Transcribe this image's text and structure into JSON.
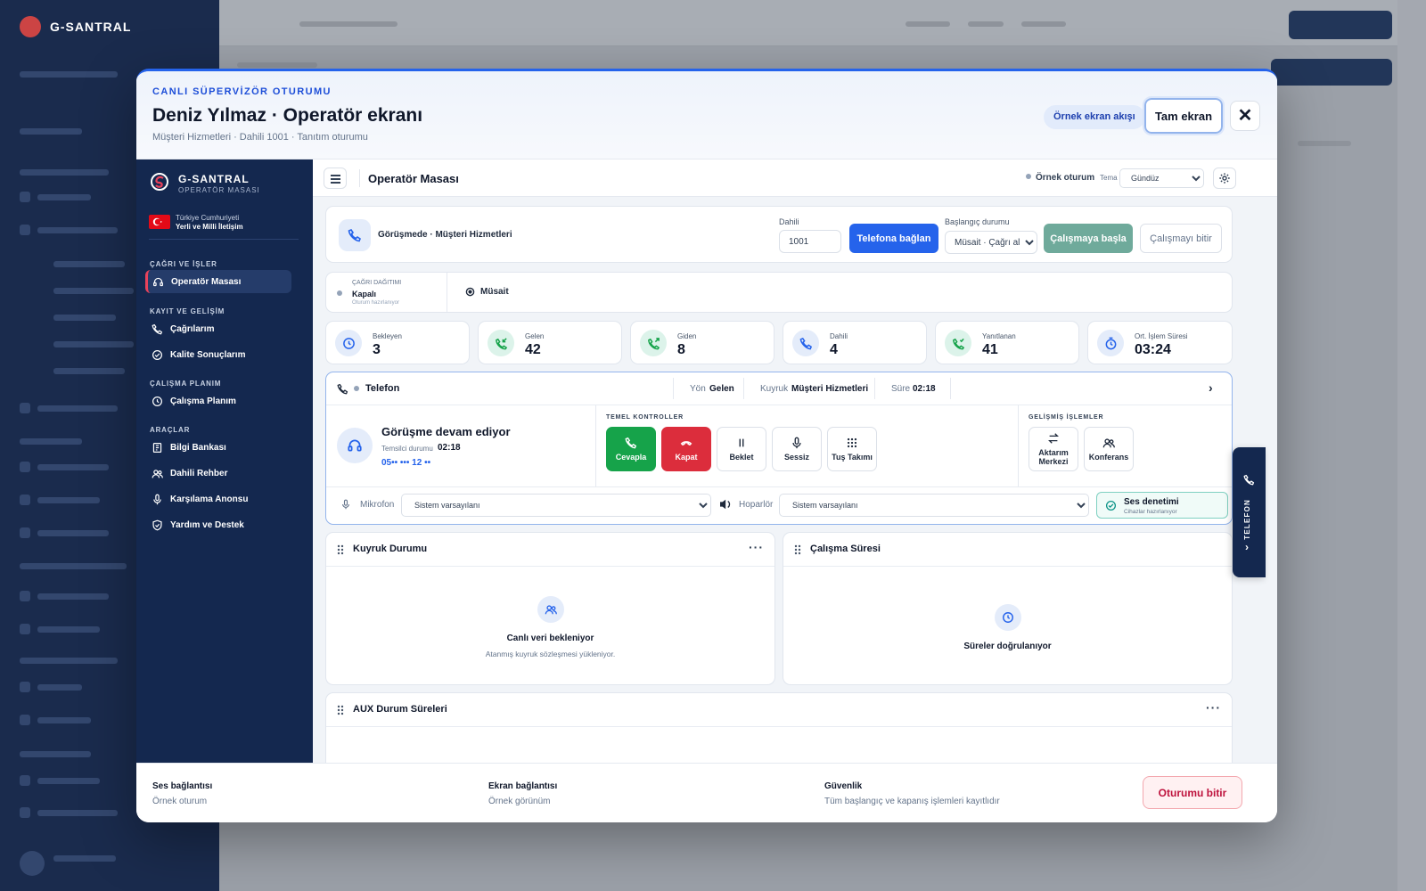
{
  "modal": {
    "eyebrow": "CANLI SÜPERVİZÖR OTURUMU",
    "title": "Deniz Yılmaz · Operatör ekranı",
    "subtitle": "Müşteri Hizmetleri · Dahili 1001 · Tanıtım oturumu",
    "flow_label": "Örnek ekran akışı",
    "fullscreen_label": "Tam ekran",
    "close_glyph": "✕"
  },
  "sidebar": {
    "brand": "G-SANTRAL",
    "brand_sub": "OPERATÖR MASASI",
    "gov_line1": "Türkiye Cumhuriyeti",
    "gov_line2": "Yerli ve Milli İletişim",
    "sections": [
      {
        "title": "ÇAĞRI VE İŞLER",
        "items": [
          {
            "label": "Operatör Masası",
            "icon": "headset-icon",
            "active": true
          }
        ]
      },
      {
        "title": "KAYIT VE GELİŞİM",
        "items": [
          {
            "label": "Çağrılarım",
            "icon": "phone-icon"
          },
          {
            "label": "Kalite Sonuçlarım",
            "icon": "check-badge-icon"
          }
        ]
      },
      {
        "title": "ÇALIŞMA PLANIM",
        "items": [
          {
            "label": "Çalışma Planım",
            "icon": "clock-icon"
          }
        ]
      },
      {
        "title": "ARAÇLAR",
        "items": [
          {
            "label": "Bilgi Bankası",
            "icon": "book-icon"
          },
          {
            "label": "Dahili Rehber",
            "icon": "contacts-icon"
          },
          {
            "label": "Karşılama Anonsu",
            "icon": "mic-icon"
          },
          {
            "label": "Yardım ve Destek",
            "icon": "shield-icon"
          }
        ]
      }
    ]
  },
  "topbar": {
    "title": "Operatör Masası",
    "session": "Örnek oturum",
    "theme_label": "Tema",
    "theme_value": "Gündüz"
  },
  "connect": {
    "status": "Görüşmede · Müşteri Hizmetleri",
    "ext_label": "Dahili",
    "ext_value": "1001",
    "connect_btn": "Telefona bağlan",
    "start_status_label": "Başlangıç durumu",
    "start_status_value": "Müsait · Çağrı al",
    "start_btn": "Çalışmaya başla",
    "stop_btn": "Çalışmayı bitir",
    "colors": {
      "primary": "#2563eb",
      "start": "#6faa9b"
    }
  },
  "distribution": {
    "label": "ÇAĞRI DAĞITIMI",
    "value": "Kapalı",
    "note": "Oturum hazırlanıyor",
    "availability": "Müsait"
  },
  "stats": [
    {
      "label": "Bekleyen",
      "value": "3",
      "icon": "clock-icon",
      "tone": "blue"
    },
    {
      "label": "Gelen",
      "value": "42",
      "icon": "incoming-call-icon",
      "tone": "green"
    },
    {
      "label": "Giden",
      "value": "8",
      "icon": "outgoing-call-icon",
      "tone": "green"
    },
    {
      "label": "Dahili",
      "value": "4",
      "icon": "phone-icon",
      "tone": "blue"
    },
    {
      "label": "Yanıtlanan",
      "value": "41",
      "icon": "answered-call-icon",
      "tone": "green"
    },
    {
      "label": "Ort. İşlem Süresi",
      "value": "03:24",
      "icon": "timer-icon",
      "tone": "blue"
    }
  ],
  "phone": {
    "title": "Telefon",
    "dir_label": "Yön",
    "dir_value": "Gelen",
    "queue_label": "Kuyruk",
    "queue_value": "Müşteri Hizmetleri",
    "dur_label": "Süre",
    "dur_value": "02:18",
    "call_title": "Görüşme devam ediyor",
    "rep_label": "Temsilci durumu",
    "rep_value": "02:18",
    "number": "05•• ••• 12 ••",
    "basic_title": "TEMEL KONTROLLER",
    "advanced_title": "GELİŞMİŞ İŞLEMLER",
    "controls": {
      "answer": "Cevapla",
      "hangup": "Kapat",
      "hold": "Beklet",
      "mute": "Sessiz",
      "keypad": "Tuş Takımı"
    },
    "advanced": {
      "transfer_1": "Aktarım",
      "transfer_2": "Merkezi",
      "conference": "Konferans"
    },
    "mic_label": "Mikrofon",
    "mic_value": "Sistem varsayılanı",
    "spk_label": "Hoparlör",
    "spk_value": "Sistem varsayılanı",
    "audio_check": "Ses denetimi",
    "audio_check_sub": "Cihazlar hazırlanıyor",
    "colors": {
      "answer": "#16a34a",
      "hangup": "#dc2d3c"
    }
  },
  "panels": {
    "queue_title": "Kuyruk Durumu",
    "queue_empty_title": "Canlı veri bekleniyor",
    "queue_empty_sub": "Atanmış kuyruk sözleşmesi yükleniyor.",
    "work_title": "Çalışma Süresi",
    "work_empty_title": "Süreler doğrulanıyor",
    "aux_title": "AUX Durum Süreleri"
  },
  "side_tab": "TELEFON",
  "footer": {
    "items": [
      {
        "label": "Ses bağlantısı",
        "value": "Örnek oturum"
      },
      {
        "label": "Ekran bağlantısı",
        "value": "Örnek görünüm"
      },
      {
        "label": "Güvenlik",
        "value": "Tüm başlangıç ve kapanış işlemleri kayıtlıdır"
      }
    ],
    "end_btn": "Oturumu bitir"
  }
}
